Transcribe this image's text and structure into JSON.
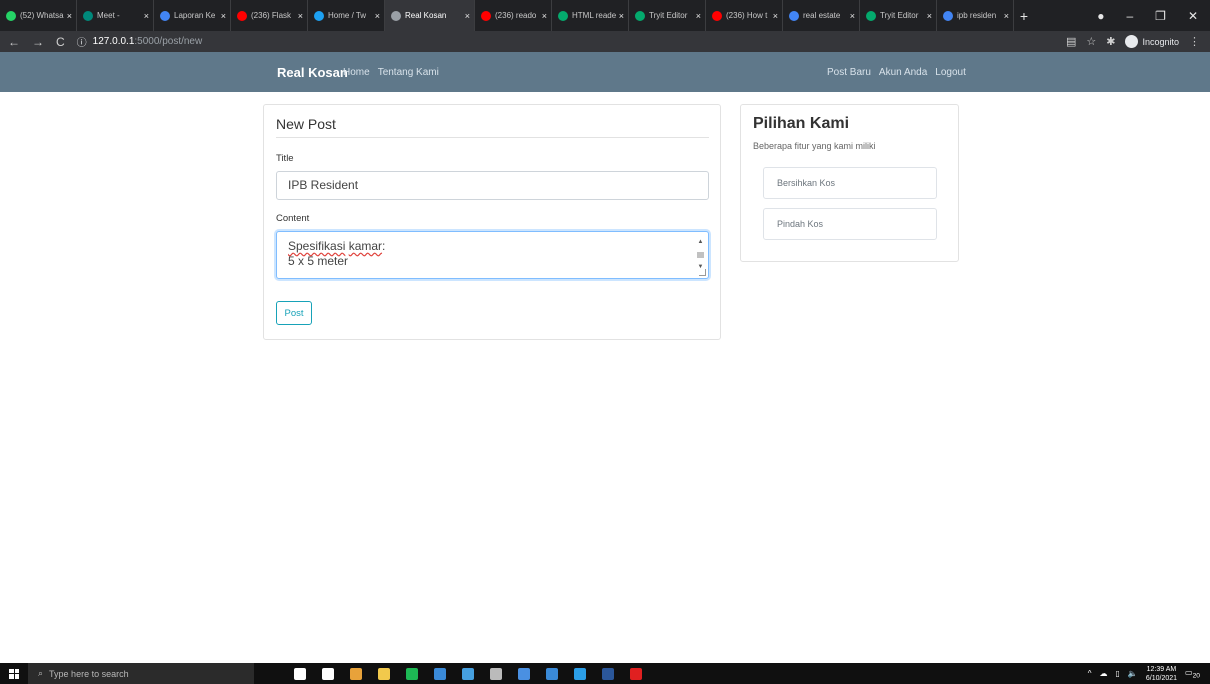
{
  "browser": {
    "tabs": [
      {
        "label": "(52) Whatsa",
        "color": "#25d366"
      },
      {
        "label": "Meet -",
        "color": "#00897b"
      },
      {
        "label": "Laporan Ke",
        "color": "#4285f4"
      },
      {
        "label": "(236) Flask",
        "color": "#ff0000"
      },
      {
        "label": "Home / Tw",
        "color": "#1da1f2"
      },
      {
        "label": "Real Kosan",
        "color": "#9aa0a6",
        "active": true
      },
      {
        "label": "(236) reado",
        "color": "#ff0000"
      },
      {
        "label": "HTML reade",
        "color": "#04aa6d"
      },
      {
        "label": "Tryit Editor",
        "color": "#04aa6d"
      },
      {
        "label": "(236) How t",
        "color": "#ff0000"
      },
      {
        "label": "real estate",
        "color": "#4285f4"
      },
      {
        "label": "Tryit Editor",
        "color": "#04aa6d"
      },
      {
        "label": "ipb residen",
        "color": "#4285f4"
      }
    ],
    "tab_close": "×",
    "new_tab": "+",
    "url_host": "127.0.0.1",
    "url_path": ":5000/post/new",
    "incognito_label": "Incognito"
  },
  "site": {
    "brand": "Real Kosan",
    "nav_left": [
      "Home",
      "Tentang Kami"
    ],
    "nav_right": [
      "Post Baru",
      "Akun Anda",
      "Logout"
    ]
  },
  "form": {
    "legend": "New Post",
    "title_label": "Title",
    "title_value": "IPB Resident",
    "content_label": "Content",
    "content_line1_a": "Spesifikasi",
    "content_line1_b": "kamar",
    "content_line1_c": ":",
    "content_line2": "5 x 5 meter",
    "submit": "Post"
  },
  "sidebar": {
    "title": "Pilihan Kami",
    "subtitle": "Beberapa fitur yang kami miliki",
    "items": [
      "Bersihkan Kos",
      "Pindah Kos"
    ]
  },
  "taskbar": {
    "search_placeholder": "Type here to search",
    "apps": [
      {
        "name": "cortana",
        "color": "#ffffff"
      },
      {
        "name": "task-view",
        "color": "#ffffff"
      },
      {
        "name": "chrome",
        "color": "#e8a23a"
      },
      {
        "name": "file-explorer",
        "color": "#f2c94c"
      },
      {
        "name": "spotify",
        "color": "#1db954"
      },
      {
        "name": "steam-check",
        "color": "#3a8ad8"
      },
      {
        "name": "app-blue",
        "color": "#46a0e0"
      },
      {
        "name": "epic-games",
        "color": "#bbbbbb"
      },
      {
        "name": "chrome-incognito",
        "color": "#4a90e2"
      },
      {
        "name": "check-app",
        "color": "#3a8ad8"
      },
      {
        "name": "vscode",
        "color": "#2b9fe8"
      },
      {
        "name": "word",
        "color": "#2b579a"
      },
      {
        "name": "acrobat",
        "color": "#e02020"
      }
    ],
    "time": "12:39 AM",
    "date": "6/10/2021",
    "notification_count": "20"
  }
}
